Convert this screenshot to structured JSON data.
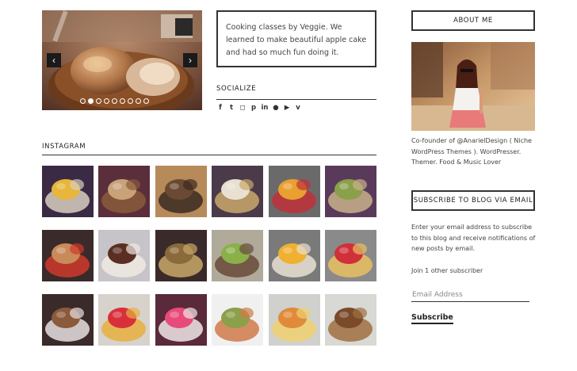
{
  "slider": {
    "prev_icon": "chevron-left-icon",
    "next_icon": "chevron-right-icon",
    "prev_glyph": "‹",
    "next_glyph": "›",
    "slide_count": 9,
    "active_slide": 2
  },
  "intro": {
    "text": "Cooking classes by Veggie. We learned to make beautiful apple cake and had so much fun doing it."
  },
  "socialize": {
    "heading": "SOCIALIZE",
    "icons": [
      {
        "name": "facebook-icon",
        "glyph": "f"
      },
      {
        "name": "twitter-icon",
        "glyph": "t"
      },
      {
        "name": "instagram-icon",
        "glyph": "◻"
      },
      {
        "name": "pinterest-icon",
        "glyph": "p"
      },
      {
        "name": "linkedin-icon",
        "glyph": "in"
      },
      {
        "name": "github-icon",
        "glyph": "●"
      },
      {
        "name": "youtube-icon",
        "glyph": "▶"
      },
      {
        "name": "vine-icon",
        "glyph": "v"
      }
    ]
  },
  "instagram": {
    "heading": "INSTAGRAM",
    "photos": [
      {
        "name": "mango-chia-pudding-photo",
        "colors": [
          "#3a2a44",
          "#e7b63a",
          "#d9cfc0"
        ]
      },
      {
        "name": "flatbread-crackers-photo",
        "colors": [
          "#5a2e3a",
          "#c9a27a",
          "#8a5a3a"
        ]
      },
      {
        "name": "energy-balls-bowl-photo",
        "colors": [
          "#b78a5a",
          "#6a4a32",
          "#3a2a22"
        ]
      },
      {
        "name": "overnight-oats-jar-photo",
        "colors": [
          "#4a3a4a",
          "#e8e0d0",
          "#c9a86a"
        ]
      },
      {
        "name": "berry-mango-jar-photo",
        "colors": [
          "#6a6a6a",
          "#e8a030",
          "#c0303a"
        ]
      },
      {
        "name": "green-crackers-photo",
        "colors": [
          "#5a3a5a",
          "#8aa04a",
          "#c9b08a"
        ]
      },
      {
        "name": "crackers-plate-photo",
        "colors": [
          "#3a2a2a",
          "#c98a5a",
          "#d03a2a"
        ]
      },
      {
        "name": "coconut-truffles-photo",
        "colors": [
          "#c6c4c8",
          "#5a2e22",
          "#f0eae2"
        ]
      },
      {
        "name": "seed-crackers-bowl-photo",
        "colors": [
          "#3a2a2a",
          "#8a6a3a",
          "#c9a86a"
        ]
      },
      {
        "name": "green-smoothie-photo",
        "colors": [
          "#b0aa9a",
          "#8ab04a",
          "#6a4a3a"
        ]
      },
      {
        "name": "mango-parfait-jar-photo",
        "colors": [
          "#7a7a7a",
          "#f0b030",
          "#e8e0d4"
        ]
      },
      {
        "name": "raspberry-parfait-jar-photo",
        "colors": [
          "#8a8a8a",
          "#d0303a",
          "#e8c060"
        ]
      },
      {
        "name": "bliss-balls-bowl-photo",
        "colors": [
          "#3a2a2a",
          "#8a5a3a",
          "#e8e0e0"
        ]
      },
      {
        "name": "raspberry-dessert-glass-photo",
        "colors": [
          "#d8d2cc",
          "#d8303a",
          "#e8b040"
        ]
      },
      {
        "name": "pink-soup-photo",
        "colors": [
          "#5a2a3a",
          "#e84a7a",
          "#f0e8e8"
        ]
      },
      {
        "name": "vegetable-soup-photo",
        "colors": [
          "#f0f0f0",
          "#8aa04a",
          "#d07a4a"
        ]
      },
      {
        "name": "pasta-salad-photo",
        "colors": [
          "#d0d0cc",
          "#e08a3a",
          "#f0d070"
        ]
      },
      {
        "name": "granola-bars-photo",
        "colors": [
          "#d8d8d4",
          "#7a4a2a",
          "#a07040"
        ]
      }
    ]
  },
  "about": {
    "heading": "ABOUT ME",
    "bio": "Co-founder of @AnarielDesign ( Niche WordPress Themes ). WordPresser. Themer. Food & Music Lover"
  },
  "subscribe": {
    "heading": "SUBSCRIBE TO BLOG VIA EMAIL",
    "description": "Enter your email address to subscribe to this blog and receive notifications of new posts by email.",
    "subscriber_count": "Join 1 other subscriber",
    "email_placeholder": "Email Address",
    "button_label": "Subscribe"
  }
}
